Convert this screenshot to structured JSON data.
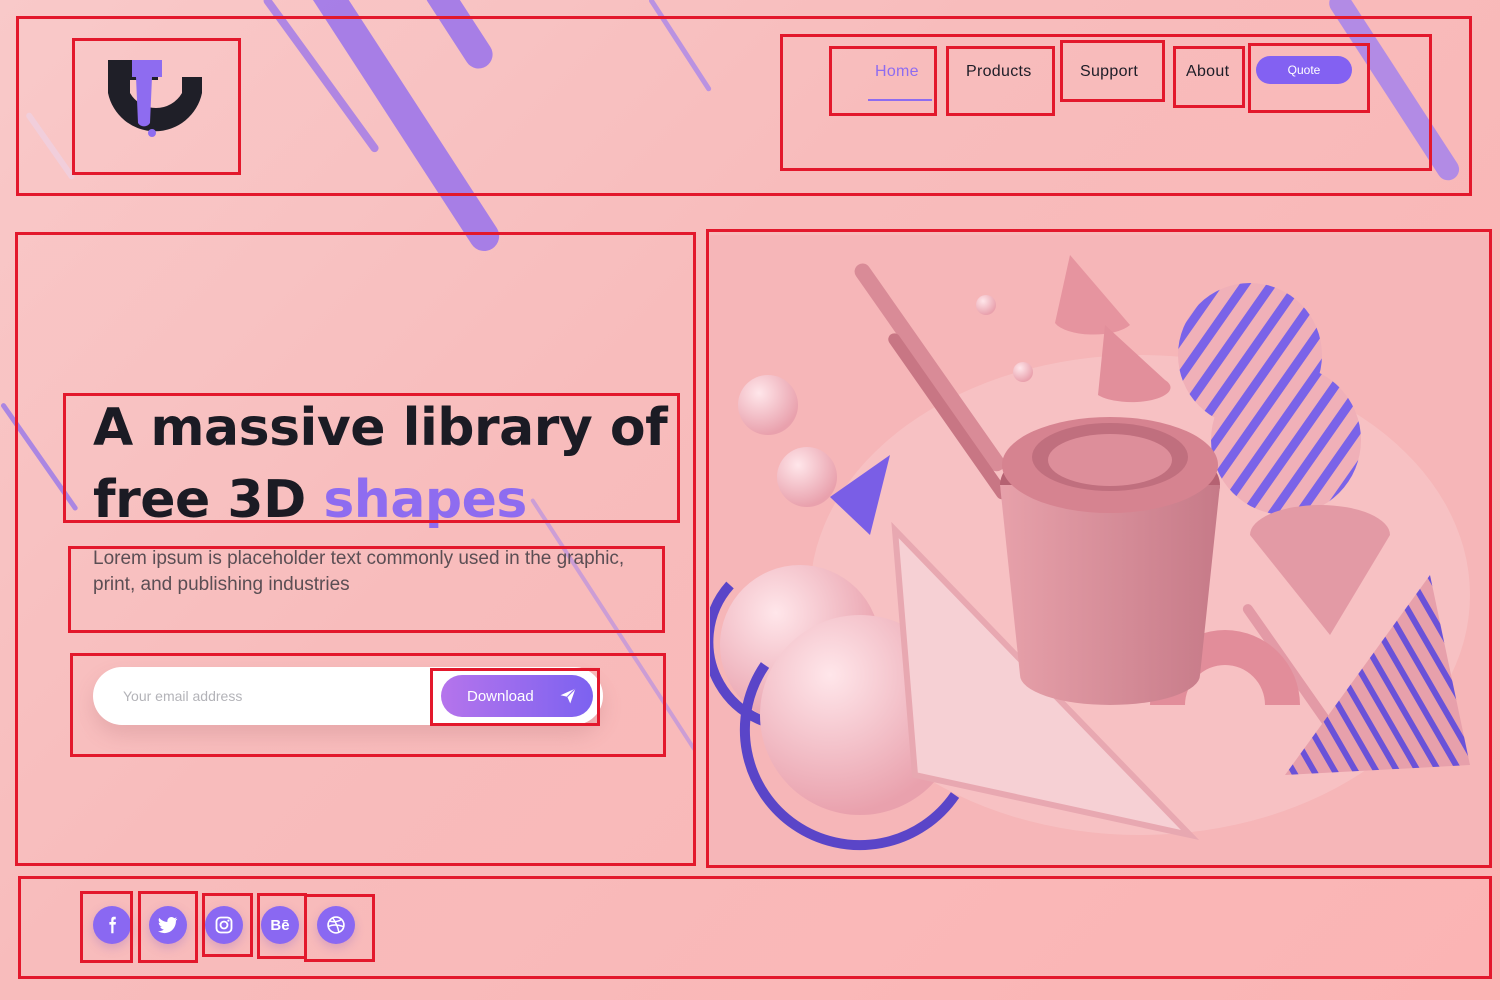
{
  "header": {
    "logo_icon": "brand-logo",
    "nav": [
      {
        "label": "Home",
        "active": true
      },
      {
        "label": "Products",
        "active": false
      },
      {
        "label": "Support",
        "active": false
      },
      {
        "label": "About",
        "active": false
      }
    ],
    "quote_label": "Quote"
  },
  "hero": {
    "headline_part1": "A massive library of",
    "headline_part2": "free 3D ",
    "headline_accent": "shapes",
    "subtext": "Lorem ipsum is placeholder text commonly used in the graphic, print, and publishing industries",
    "email_placeholder": "Your email address",
    "download_label": "Download"
  },
  "social": [
    {
      "icon": "facebook-icon",
      "glyph": "f"
    },
    {
      "icon": "twitter-icon",
      "glyph": "t"
    },
    {
      "icon": "instagram-icon",
      "glyph": "ig"
    },
    {
      "icon": "behance-icon",
      "glyph": "Bē"
    },
    {
      "icon": "dribbble-icon",
      "glyph": "db"
    }
  ],
  "colors": {
    "accent": "#8e6cf0",
    "annotation": "#e3182c",
    "background": "#f8bcbc",
    "text": "#1d1d27"
  }
}
